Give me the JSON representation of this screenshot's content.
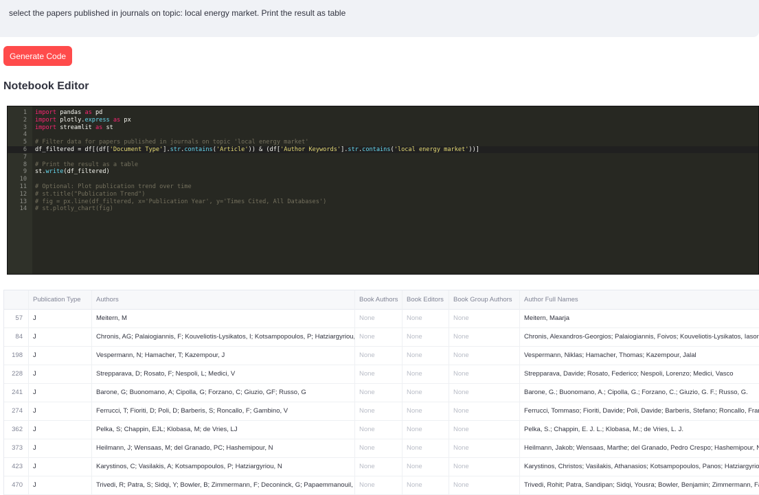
{
  "prompt": {
    "text": "select the papers published in journals on topic: local energy market. Print the result as table"
  },
  "generate_button": {
    "label": "Generate Code"
  },
  "notebook": {
    "title": "Notebook Editor"
  },
  "code_lines": [
    "import pandas as pd",
    "import plotly.express as px",
    "import streamlit as st",
    "",
    "# Filter data for papers published in journals on topic 'local energy market'",
    "df_filtered = df[(df['Document Type'].str.contains('Article')) & (df['Author Keywords'].str.contains('local energy market'))]",
    "",
    "# Print the result as a table",
    "st.write(df_filtered)",
    "",
    "# Optional: Plot publication trend over time",
    "# st.title(\"Publication Trend\")",
    "# fig = px.line(df_filtered, x='Publication Year', y='Times Cited, All Databases')",
    "# st.plotly_chart(fig)"
  ],
  "table": {
    "columns": [
      "",
      "Publication Type",
      "Authors",
      "Book Authors",
      "Book Editors",
      "Book Group Authors",
      "Author Full Names"
    ],
    "rows": [
      [
        "57",
        "J",
        "Meitern, M",
        "None",
        "None",
        "None",
        "Meitern, Maarja"
      ],
      [
        "84",
        "J",
        "Chronis, AG; Palaiogiannis, F; Kouveliotis-Lysikatos, I; Kotsampopoulos, P; Hatziargyriou, N",
        "None",
        "None",
        "None",
        "Chronis, Alexandros-Georgios; Palaiogiannis, Foivos; Kouveliotis-Lysikatos, Iasonas"
      ],
      [
        "198",
        "J",
        "Vespermann, N; Hamacher, T; Kazempour, J",
        "None",
        "None",
        "None",
        "Vespermann, Niklas; Hamacher, Thomas; Kazempour, Jalal"
      ],
      [
        "228",
        "J",
        "Strepparava, D; Rosato, F; Nespoli, L; Medici, V",
        "None",
        "None",
        "None",
        "Strepparava, Davide; Rosato, Federico; Nespoli, Lorenzo; Medici, Vasco"
      ],
      [
        "241",
        "J",
        "Barone, G; Buonomano, A; Cipolla, G; Forzano, C; Giuzio, GF; Russo, G",
        "None",
        "None",
        "None",
        "Barone, G.; Buonomano, A.; Cipolla, G.; Forzano, C.; Giuzio, G. F.; Russo, G."
      ],
      [
        "274",
        "J",
        "Ferrucci, T; Fioriti, D; Poli, D; Barberis, S; Roncallo, F; Gambino, V",
        "None",
        "None",
        "None",
        "Ferrucci, Tommaso; Fioriti, Davide; Poli, Davide; Barberis, Stefano; Roncallo, Francesca"
      ],
      [
        "362",
        "J",
        "Pelka, S; Chappin, EJL; Klobasa, M; de Vries, LJ",
        "None",
        "None",
        "None",
        "Pelka, S.; Chappin, E. J. L.; Klobasa, M.; de Vries, L. J."
      ],
      [
        "373",
        "J",
        "Heilmann, J; Wensaas, M; del Granado, PC; Hashemipour, N",
        "None",
        "None",
        "None",
        "Heilmann, Jakob; Wensaas, Marthe; del Granado, Pedro Crespo; Hashemipour, Naser"
      ],
      [
        "423",
        "J",
        "Karystinos, C; Vasilakis, A; Kotsampopoulos, P; Hatziargyriou, N",
        "None",
        "None",
        "None",
        "Karystinos, Christos; Vasilakis, Athanasios; Kotsampopoulos, Panos; Hatziargyriou, Nikos"
      ],
      [
        "470",
        "J",
        "Trivedi, R; Patra, S; Sidqi, Y; Bowler, B; Zimmermann, F; Deconinck, G; Papaemmanouil, A",
        "None",
        "None",
        "None",
        "Trivedi, Rohit; Patra, Sandipan; Sidqi, Yousra; Bowler, Benjamin; Zimmermann, Fabian"
      ],
      [
        "",
        "",
        "",
        "None",
        "None",
        "None",
        ""
      ]
    ]
  },
  "colors": {
    "accent_button": "#ff4b4b",
    "editor_bg": "#272822",
    "prompt_bg": "#f0f2f6"
  }
}
